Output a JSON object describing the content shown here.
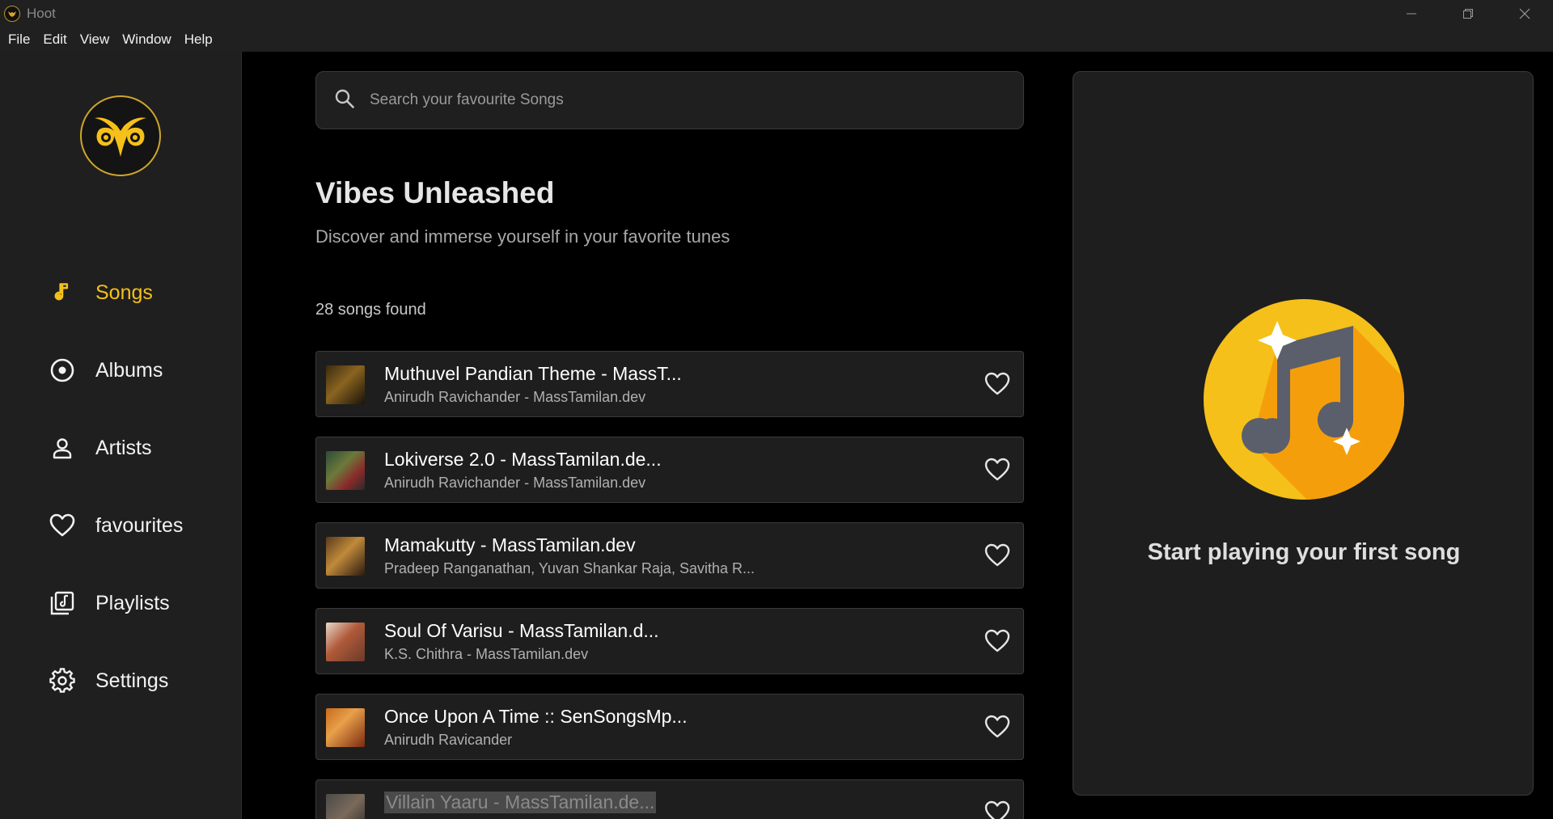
{
  "window": {
    "title": "Hoot"
  },
  "menu": [
    "File",
    "Edit",
    "View",
    "Window",
    "Help"
  ],
  "sidebar": {
    "items": [
      {
        "label": "Songs",
        "icon": "music-note-icon",
        "active": true
      },
      {
        "label": "Albums",
        "icon": "disc-icon",
        "active": false
      },
      {
        "label": "Artists",
        "icon": "person-icon",
        "active": false
      },
      {
        "label": "favourites",
        "icon": "heart-icon",
        "active": false
      },
      {
        "label": "Playlists",
        "icon": "playlist-icon",
        "active": false
      },
      {
        "label": "Settings",
        "icon": "gear-icon",
        "active": false
      }
    ]
  },
  "main": {
    "search": {
      "placeholder": "Search your favourite Songs"
    },
    "heading": "Vibes Unleashed",
    "subheading": "Discover and immerse yourself in your favorite tunes",
    "count": "28 songs found",
    "songs": [
      {
        "title": "Muthuvel Pandian Theme - MassT...",
        "artist": "Anirudh Ravichander - MassTamilan.dev"
      },
      {
        "title": "Lokiverse 2.0 - MassTamilan.de...",
        "artist": "Anirudh Ravichander - MassTamilan.dev"
      },
      {
        "title": "Mamakutty - MassTamilan.dev",
        "artist": "Pradeep Ranganathan, Yuvan Shankar Raja, Savitha R..."
      },
      {
        "title": "Soul Of Varisu - MassTamilan.d...",
        "artist": "K.S. Chithra - MassTamilan.dev"
      },
      {
        "title": "Once Upon A Time :: SenSongsMp...",
        "artist": "Anirudh Ravicander"
      },
      {
        "title": "Villain Yaaru - MassTamilan.de...",
        "artist": ""
      }
    ]
  },
  "player": {
    "message": "Start playing your first song"
  },
  "colors": {
    "accent": "#f5c01a",
    "background": "#000000",
    "panel": "#1e1e1e",
    "sidebar": "#1f1f1f"
  }
}
